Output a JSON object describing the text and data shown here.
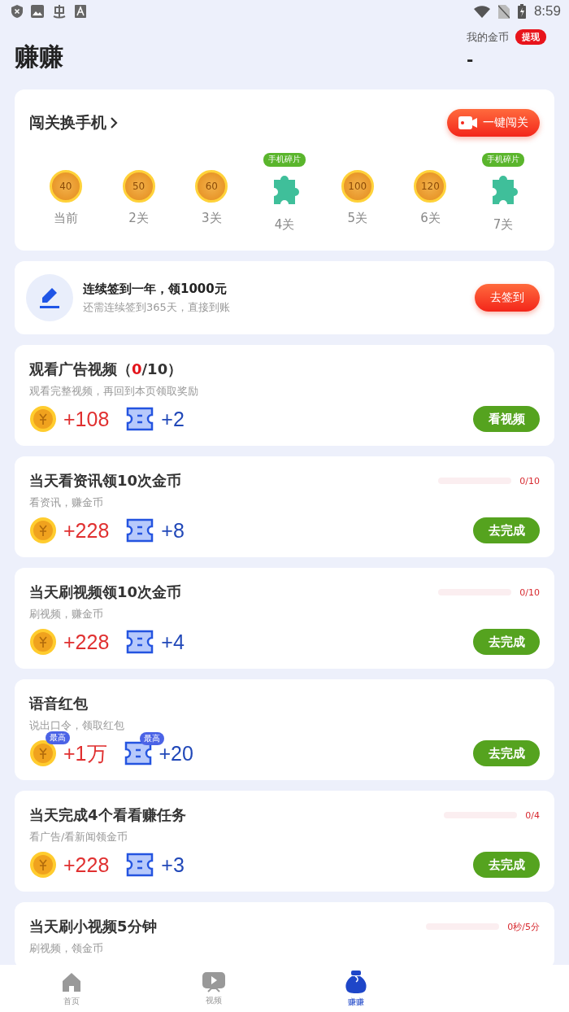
{
  "status_bar": {
    "time": "8:59"
  },
  "header": {
    "title": "赚赚",
    "coins_label": "我的金币",
    "withdraw": "提现",
    "coins_value": "-"
  },
  "challenge": {
    "title": "闯关换手机",
    "button": "一键闯关",
    "levels": [
      {
        "kind": "coin",
        "value": "40",
        "label": "当前"
      },
      {
        "kind": "coin",
        "value": "50",
        "label": "2关"
      },
      {
        "kind": "coin",
        "value": "60",
        "label": "3关"
      },
      {
        "kind": "puzzle",
        "tag": "手机碎片",
        "label": "4关"
      },
      {
        "kind": "coin",
        "value": "100",
        "label": "5关"
      },
      {
        "kind": "coin",
        "value": "120",
        "label": "6关"
      },
      {
        "kind": "puzzle",
        "tag": "手机碎片",
        "label": "7关"
      }
    ]
  },
  "signin": {
    "title": "连续签到一年，领1000元",
    "subtitle": "还需连续签到365天，直接到账",
    "button": "去签到"
  },
  "tasks": [
    {
      "title": "观看广告视频（*0*/10）",
      "subtitle": "观看完整视频，再回到本页领取奖励",
      "coins": "+108",
      "tickets": "+2",
      "button": "看视频"
    },
    {
      "title": "当天看资讯领10次金币",
      "subtitle": "看资讯，赚金币",
      "progress": {
        "level": 0,
        "reading": "0/10"
      },
      "coins": "+228",
      "tickets": "+8",
      "button": "去完成"
    },
    {
      "title": "当天刷视频领10次金币",
      "subtitle": "刷视频，赚金币",
      "progress": {
        "level": 0,
        "reading": "0/10"
      },
      "coins": "+228",
      "tickets": "+4",
      "button": "去完成"
    },
    {
      "title": "语音红包",
      "subtitle": "说出口令，领取红包",
      "coins": "+1万",
      "coins_badge": "最高",
      "tickets": "+20",
      "tickets_badge": "最高",
      "button": "去完成"
    },
    {
      "title": "当天完成4个看看赚任务",
      "subtitle": "看广告/看新闻领金币",
      "progress": {
        "level": 0,
        "reading": "0/4"
      },
      "coins": "+228",
      "tickets": "+3",
      "button": "去完成"
    },
    {
      "title": "当天刷小视频5分钟",
      "subtitle": "刷视频，领金币",
      "progress": {
        "level": 0,
        "reading": "0秒/5分"
      }
    }
  ],
  "nav": [
    {
      "kind": "home",
      "label": "首页",
      "selected": false
    },
    {
      "kind": "video",
      "label": "视频",
      "selected": false
    },
    {
      "kind": "bag",
      "label": "赚赚",
      "selected": true
    }
  ]
}
